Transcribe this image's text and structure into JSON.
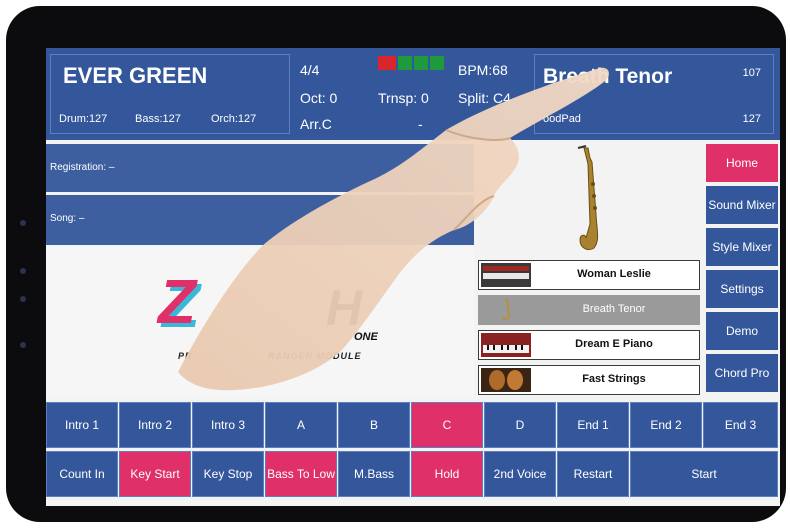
{
  "header": {
    "song_title": "EVER GREEN",
    "drum": "Drum:127",
    "bass": "Bass:127",
    "orch": "Orch:127",
    "time_sig": "4/4",
    "oct": "Oct: 0",
    "arr": "Arr.C",
    "trnsp": "Trnsp: 0",
    "dash": "-",
    "bpm": "BPM:68",
    "split": "Split: C4",
    "voice_title": "Breath Tenor",
    "voice_num": "107",
    "pad_label": "oodPad",
    "pad_num": "127"
  },
  "info": {
    "registration": "Registration: –",
    "song": "Song: –"
  },
  "logo": {
    "letter_z": "Z",
    "letter_h": "H",
    "one": "ONE",
    "sub_left": "PR",
    "sub_right": "RANGER MODULE"
  },
  "nav": {
    "home": "Home",
    "sound_mixer": "Sound Mixer",
    "style_mixer": "Style Mixer",
    "settings": "Settings",
    "demo": "Demo",
    "chord_pro": "Chord Pro"
  },
  "voices": [
    {
      "name": "Woman Leslie"
    },
    {
      "name": "Breath Tenor"
    },
    {
      "name": "Dream E Piano"
    },
    {
      "name": "Fast Strings"
    }
  ],
  "row1": [
    "Intro 1",
    "Intro 2",
    "Intro 3",
    "A",
    "B",
    "C",
    "D",
    "End 1",
    "End 2",
    "End 3"
  ],
  "row2": [
    "Count In",
    "Key Start",
    "Key Stop",
    "Bass To Low",
    "M.Bass",
    "Hold",
    "2nd Voice",
    "Restart",
    "Start"
  ],
  "colors": {
    "accent": "#e0306a",
    "panel": "#34579b",
    "indicator_red": "#d8262c",
    "indicator_green": "#1e9a3c"
  }
}
